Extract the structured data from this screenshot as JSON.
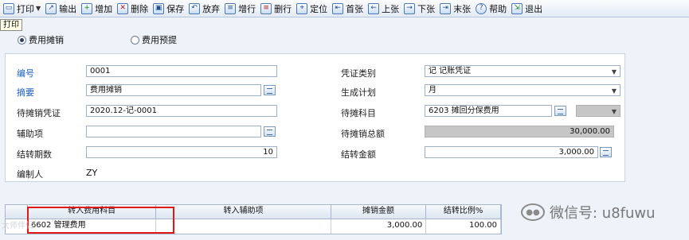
{
  "toolbar": {
    "print": "打印",
    "export": "输出",
    "add": "增加",
    "delete": "删除",
    "save": "保存",
    "discard": "放弃",
    "add_row": "增行",
    "delete_row": "删行",
    "locate": "定位",
    "first": "首张",
    "prev": "上张",
    "next": "下张",
    "last": "末张",
    "help": "帮助",
    "exit": "退出"
  },
  "tooltip": "打印",
  "mode": {
    "option1": "费用摊销",
    "option2": "费用预提",
    "selected": "费用摊销"
  },
  "form": {
    "number_label": "编号",
    "number_value": "0001",
    "summary_label": "摘要",
    "summary_value": "费用摊销",
    "pending_voucher_label": "待摊销凭证",
    "pending_voucher_value": "2020.12-记-0001",
    "aux_label": "辅助项",
    "aux_value": "",
    "periods_label": "结转期数",
    "periods_value": "10",
    "creator_label": "编制人",
    "creator_value": "ZY",
    "voucher_type_label": "凭证类别",
    "voucher_type_value": "记 记账凭证",
    "generate_plan_label": "生成计划",
    "generate_plan_value": "月",
    "pending_account_label": "待摊科目",
    "pending_account_value": "6203 摊回分保费用",
    "pending_total_label": "待摊销总额",
    "pending_total_value": "30,000.00",
    "transfer_amount_label": "结转金额",
    "transfer_amount_value": "3,000.00"
  },
  "grid": {
    "headers": [
      "转入费用科目",
      "转入辅助项",
      "摊销金额",
      "结转比例%"
    ],
    "rows": [
      {
        "account": "6602 管理费用",
        "aux": "",
        "amount": "3,000.00",
        "ratio": "100.00"
      }
    ]
  },
  "watermark": {
    "left": "大师伴侣",
    "right": "微信号: u8fuwu"
  },
  "colors": {
    "accent_blue": "#1d5fbf",
    "highlight_red": "#e01818"
  }
}
